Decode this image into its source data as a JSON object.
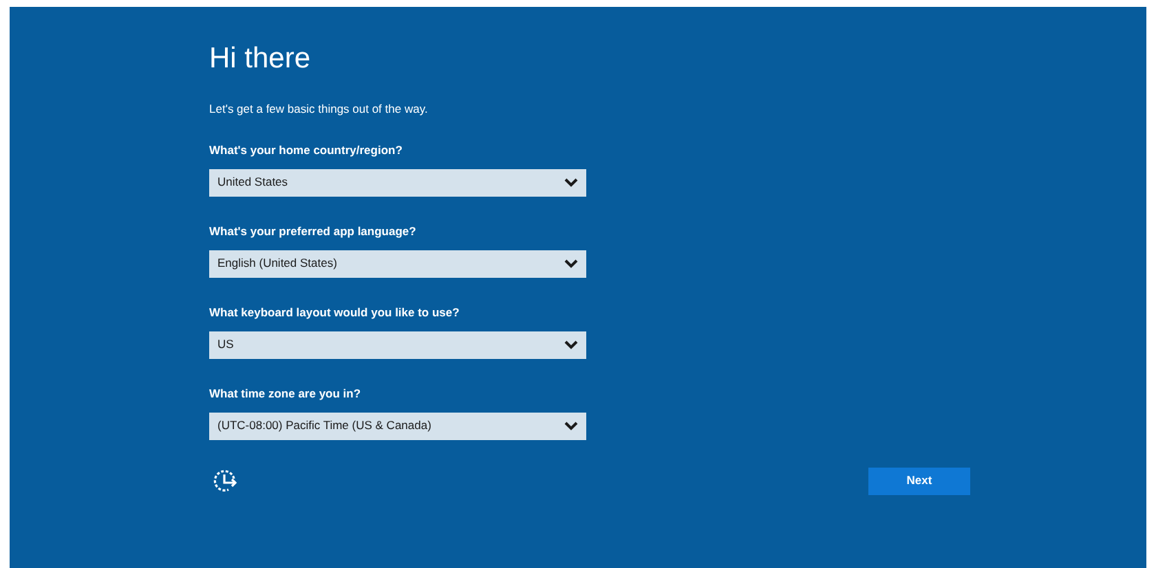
{
  "title": "Hi there",
  "subtitle": "Let's get a few basic things out of the way.",
  "questions": [
    {
      "label": "What's your home country/region?",
      "value": "United States"
    },
    {
      "label": "What's your preferred app language?",
      "value": "English (United States)"
    },
    {
      "label": "What keyboard layout would you like to use?",
      "value": "US"
    },
    {
      "label": "What time zone are you in?",
      "value": "(UTC-08:00) Pacific Time (US & Canada)"
    }
  ],
  "next_button": "Next"
}
